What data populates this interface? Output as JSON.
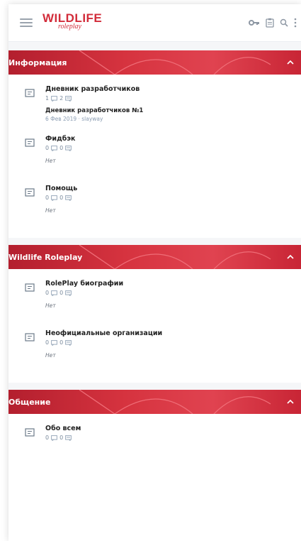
{
  "header": {
    "logo_main": "WILDLIFE",
    "logo_sub": "roleplay",
    "icons": [
      "menu-icon",
      "key-icon",
      "clipboard-icon",
      "search-icon",
      "more-vertical-icon"
    ]
  },
  "colors": {
    "accent": "#d22c3a",
    "meta": "#7a8a9c"
  },
  "sections": [
    {
      "title": "Информация",
      "forums": [
        {
          "name": "Дневник разработчиков",
          "threads": "1",
          "messages": "2",
          "last_title": "Дневник разработчиков №1",
          "last_meta": "6 Фев 2019 · slayway"
        },
        {
          "name": "Фидбэк",
          "threads": "0",
          "messages": "0",
          "none": "Нет"
        },
        {
          "name": "Помощь",
          "threads": "0",
          "messages": "0",
          "none": "Нет"
        }
      ]
    },
    {
      "title": "Wildlife Roleplay",
      "forums": [
        {
          "name": "RolePlay биографии",
          "threads": "0",
          "messages": "0",
          "none": "Нет"
        },
        {
          "name": "Неофициальные организации",
          "threads": "0",
          "messages": "0",
          "none": "Нет"
        }
      ]
    },
    {
      "title": "Общение",
      "forums": [
        {
          "name": "Обо всем",
          "threads": "0",
          "messages": "0"
        }
      ]
    }
  ]
}
